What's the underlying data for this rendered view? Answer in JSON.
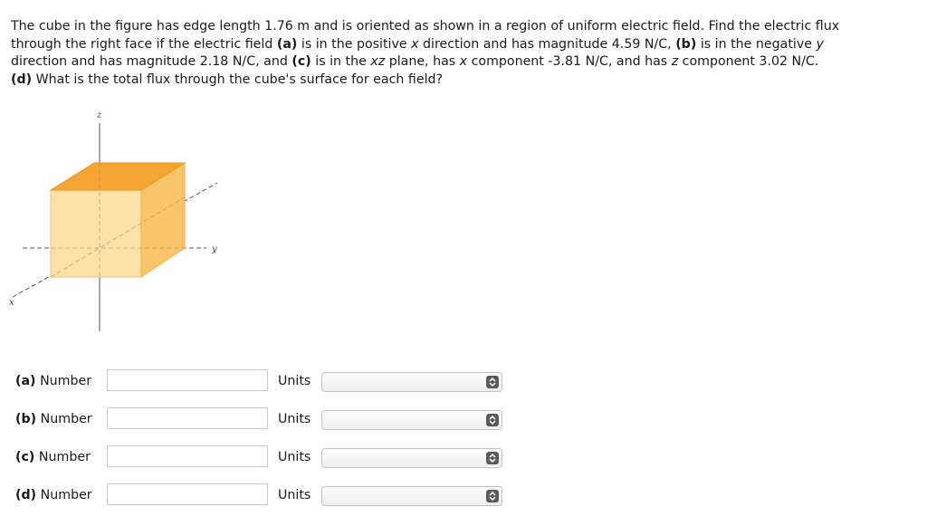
{
  "question": {
    "line1_text": "The cube in the figure has edge length 1.76 m and is oriented as shown in a region of uniform electric field. Find the electric flux",
    "line2_a": "through the right face if the electric field ",
    "line2_b": "(a)",
    "line2_c": " is in the positive ",
    "line2_d": "x",
    "line2_e": " direction and has magnitude 4.59 N/C, ",
    "line2_f": "(b)",
    "line2_g": " is in the negative ",
    "line2_h": "y",
    "line3_a": "direction and has magnitude 2.18 N/C, and ",
    "line3_b": "(c)",
    "line3_c": " is in the ",
    "line3_d": "xz",
    "line3_e": " plane, has ",
    "line3_f": "x",
    "line3_g": " component -3.81 N/C, and has ",
    "line3_h": "z",
    "line3_i": " component 3.02 N/C.",
    "line4_a": "(d)",
    "line4_b": " What is the total flux through the cube's surface for each field?"
  },
  "figure": {
    "axis_z": "z",
    "axis_y": "y",
    "axis_x": "x",
    "colors": {
      "top": "#f5a534",
      "front": "#fde1a8",
      "side": "#f9c56b"
    }
  },
  "answers": [
    {
      "part": "(a)",
      "label": "Number",
      "value": "",
      "units_label": "Units",
      "units_value": ""
    },
    {
      "part": "(b)",
      "label": "Number",
      "value": "",
      "units_label": "Units",
      "units_value": ""
    },
    {
      "part": "(c)",
      "label": "Number",
      "value": "",
      "units_label": "Units",
      "units_value": ""
    },
    {
      "part": "(d)",
      "label": "Number",
      "value": "",
      "units_label": "Units",
      "units_value": ""
    }
  ]
}
